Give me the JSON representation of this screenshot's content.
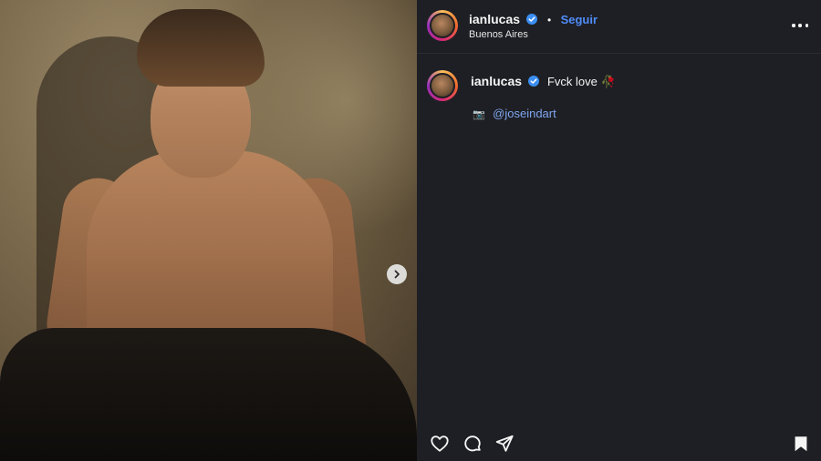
{
  "post": {
    "image_alt_icon": "photo",
    "next_icon": "chevron-right-icon"
  },
  "header": {
    "username": "ianlucas",
    "separator": "•",
    "follow_label": "Seguir",
    "location": "Buenos Aires",
    "more_icon": "more-horizontal-icon"
  },
  "caption": {
    "username": "ianlucas",
    "text": "Fvck love 🥀",
    "credit_icon": "camera-icon",
    "credit_icon_glyph": "📷",
    "mention": "@joseindart"
  },
  "actions": {
    "like_icon": "heart-icon",
    "comment_icon": "comment-icon",
    "share_icon": "send-icon",
    "save_icon": "bookmark-icon"
  },
  "colors": {
    "background": "#1e1f24",
    "accent": "#4f8cf7",
    "mention": "#7fa6ef",
    "verified": "#3b8ef0"
  }
}
